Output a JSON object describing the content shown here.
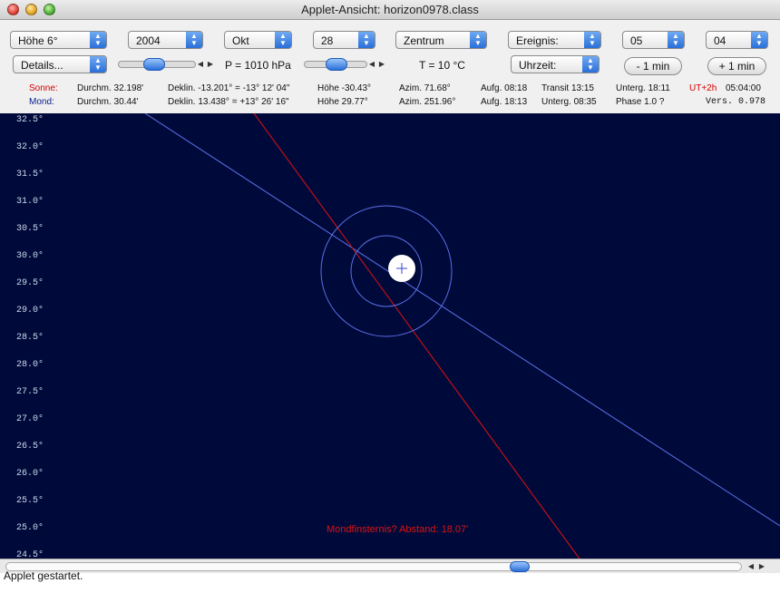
{
  "window": {
    "title": "Applet-Ansicht: horizon0978.class"
  },
  "controls": {
    "hoehe": "Höhe 6°",
    "year": "2004",
    "month": "Okt",
    "day": "28",
    "mode": "Zentrum",
    "event": "Ereignis:",
    "hour": "05",
    "minute": "04",
    "details": "Details...",
    "pressure": "P = 1010 hPa",
    "temperature": "T = 10 °C",
    "uhrzeit": "Uhrzeit:",
    "minus_min": "- 1 min",
    "plus_min": "+ 1 min"
  },
  "sun": {
    "label": "Sonne:",
    "durchm": "Durchm. 32.198'",
    "deklin": "Deklin. -13.201° = -13° 12' 04\"",
    "hoehe": "Höhe -30.43°",
    "azim": "Azim. 71.68°",
    "aufg": "Aufg. 08:18",
    "transit": "Transit 13:15",
    "unterg": "Unterg. 18:11",
    "ut_offset": "UT+2h",
    "time": "05:04:00"
  },
  "moon": {
    "label": "Mond:",
    "durchm": "Durchm. 30.44'",
    "deklin": "Deklin. 13.438° = +13° 26' 16\"",
    "hoehe": "Höhe 29.77°",
    "azim": "Azim. 251.96°",
    "aufg": "Aufg. 18:13",
    "unterg": "Unterg. 08:35",
    "phase": "Phase 1.0 ?",
    "version": "Vers. 0.978"
  },
  "sky": {
    "y_ticks": [
      "32.5°",
      "32.0°",
      "31.5°",
      "31.0°",
      "30.5°",
      "30.0°",
      "29.5°",
      "29.0°",
      "28.5°",
      "28.0°",
      "27.5°",
      "27.0°",
      "26.5°",
      "26.0°",
      "25.5°",
      "25.0°",
      "24.5°"
    ],
    "eclipse_note": "Mondfinsternis? Abstand: 18.07'",
    "colors": {
      "background": "#000a3a",
      "horizon_line": "#5b6fe8",
      "ecliptic_line": "#e01010",
      "moon": "#ffffff",
      "text_warning": "#e01010"
    }
  },
  "status": {
    "text": "Applet gestartet."
  }
}
